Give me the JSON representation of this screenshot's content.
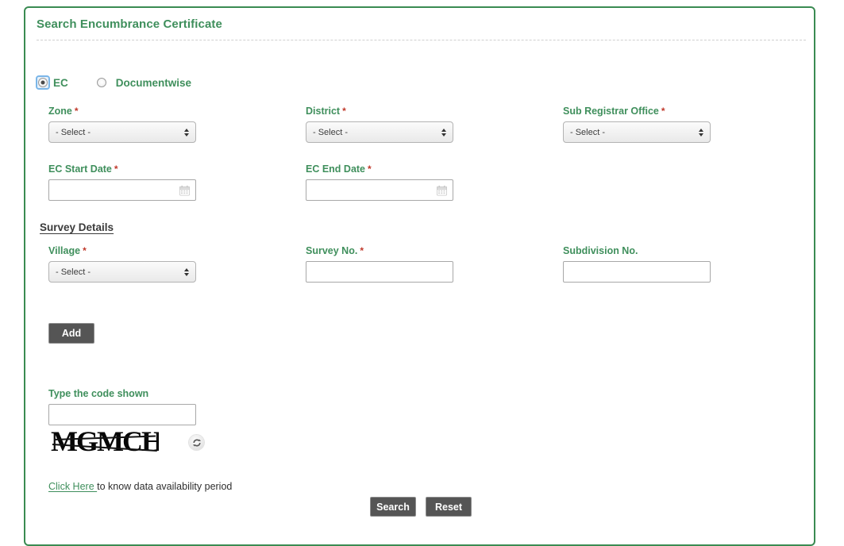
{
  "panel": {
    "title": "Search Encumbrance Certificate"
  },
  "search_mode": {
    "options": [
      {
        "label": "EC",
        "selected": true
      },
      {
        "label": "Documentwise",
        "selected": false
      }
    ]
  },
  "fields": {
    "zone": {
      "label": "Zone",
      "required": "*",
      "value": "- Select -",
      "options": [
        "- Select -"
      ]
    },
    "district": {
      "label": "District",
      "required": "*",
      "value": "- Select -",
      "options": [
        "- Select -"
      ]
    },
    "sub_registrar_office": {
      "label": "Sub Registrar Office",
      "required": "*",
      "value": "- Select -",
      "options": [
        "- Select -"
      ]
    },
    "ec_start_date": {
      "label": "EC Start Date",
      "required": "*",
      "value": "",
      "placeholder": ""
    },
    "ec_end_date": {
      "label": "EC End Date",
      "required": "*",
      "value": "",
      "placeholder": ""
    }
  },
  "survey_section": {
    "heading": "Survey Details",
    "village": {
      "label": "Village",
      "required": "*",
      "value": "- Select -",
      "options": [
        "- Select -"
      ]
    },
    "survey_no": {
      "label": "Survey No.",
      "required": "*",
      "value": "",
      "placeholder": ""
    },
    "subdivision_no": {
      "label": "Subdivision No.",
      "required": "",
      "value": "",
      "placeholder": ""
    },
    "add_button": "Add"
  },
  "captcha": {
    "label": "Type the code shown",
    "input_value": "",
    "input_placeholder": "",
    "code_text": "MGMCH",
    "refresh_icon": "refresh-icon"
  },
  "availability": {
    "link_text": "Click Here ",
    "rest_text": "to know data availability period"
  },
  "actions": {
    "search_label": "Search",
    "reset_label": "Reset"
  },
  "colors": {
    "panel_border": "#3a8b52",
    "title_green": "#3f8f5c",
    "label_green": "#3f8f5c",
    "required_red": "#c0392b",
    "button_gray": "#555555",
    "heading_dark": "#3b3b3b"
  }
}
